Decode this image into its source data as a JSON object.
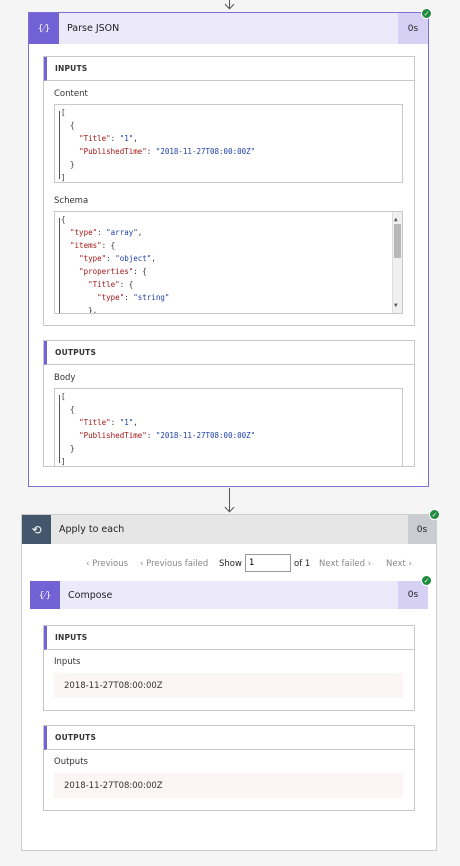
{
  "parse_json": {
    "title": "Parse JSON",
    "duration": "0s",
    "inputs_header": "INPUTS",
    "content_label": "Content",
    "content_lines": [
      "[",
      "  {",
      "    \"Title\": \"1\",",
      "    \"PublishedTime\": \"2018-11-27T08:00:00Z\"",
      "  }",
      "]"
    ],
    "schema_label": "Schema",
    "schema_lines": [
      "{",
      "  \"type\": \"array\",",
      "  \"items\": {",
      "    \"type\": \"object\",",
      "    \"properties\": {",
      "      \"Title\": {",
      "        \"type\": \"string\"",
      "      },"
    ],
    "outputs_header": "OUTPUTS",
    "body_label": "Body",
    "body_lines": [
      "[",
      "  {",
      "    \"Title\": \"1\",",
      "    \"PublishedTime\": \"2018-11-27T08:00:00Z\"",
      "  }",
      "]"
    ]
  },
  "apply_each": {
    "title": "Apply to each",
    "duration": "0s",
    "pager": {
      "previous": "‹ Previous",
      "previous_failed": "‹ Previous failed",
      "show": "Show",
      "page_value": "1",
      "of": "of 1",
      "next_failed": "Next failed ›",
      "next": "Next ›"
    }
  },
  "compose": {
    "title": "Compose",
    "duration": "0s",
    "inputs_header": "INPUTS",
    "inputs_label": "Inputs",
    "inputs_value": "2018-11-27T08:00:00Z",
    "outputs_header": "OUTPUTS",
    "outputs_label": "Outputs",
    "outputs_value": "2018-11-27T08:00:00Z"
  },
  "icons": {
    "code": "{⁄}",
    "loop": "⟲",
    "check": "✓"
  },
  "colors": {
    "action_accent": "#7361d6",
    "loop_accent": "#44566c",
    "success": "#1e8a3c"
  }
}
